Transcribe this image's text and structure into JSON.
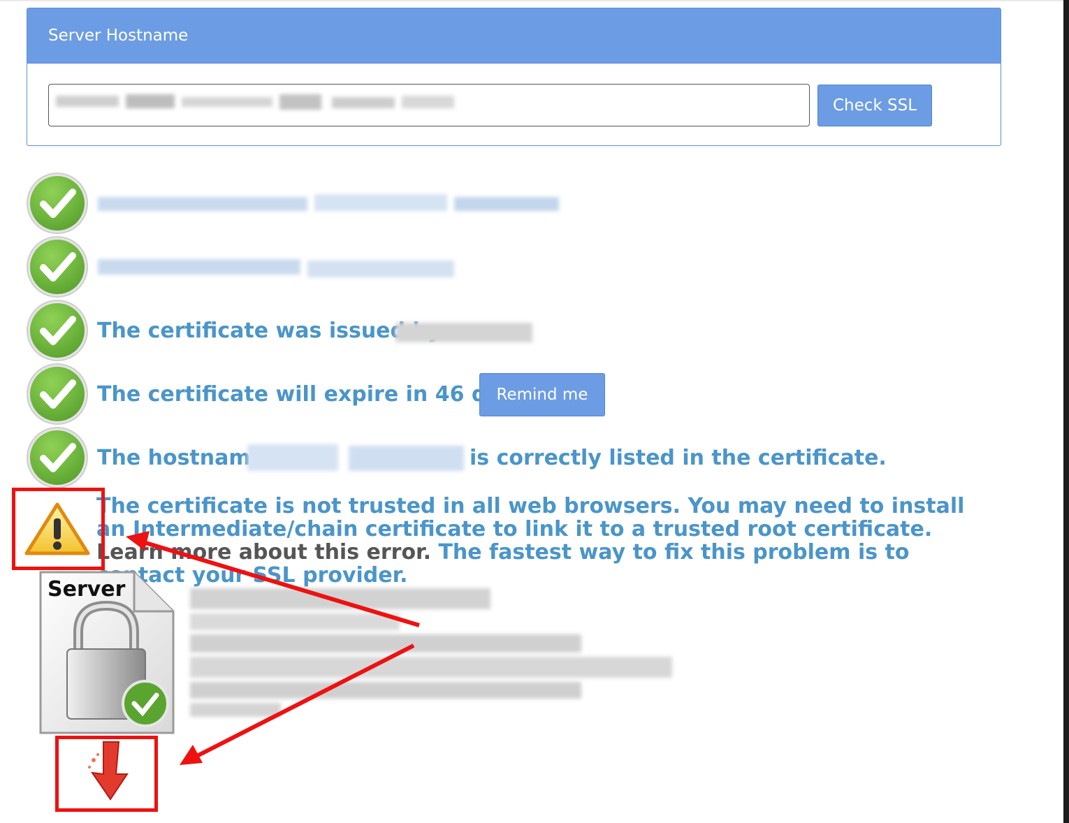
{
  "panel": {
    "title": "Server Hostname",
    "hostname_value": "",
    "check_button": "Check SSL"
  },
  "results": {
    "issued_by_text": "The certificate was issued by",
    "expire_text": "The certificate will expire in 46 days.",
    "remind_button": "Remind me",
    "hostname_prefix": "The hostname",
    "hostname_suffix": "is correctly listed in the certificate.",
    "warning_text": "The certificate is not trusted in all web browsers. You may need to install an Intermediate/chain certificate to link it to a trusted root certificate.",
    "learn_more": "Learn more about this error.",
    "warning_tail": "The fastest way to fix this problem is to contact your SSL provider."
  },
  "chain": {
    "server_label": "Server"
  },
  "colors": {
    "accent": "#6c9ce3",
    "result_text": "#4a95c9",
    "annotation_red": "#ee1111"
  },
  "icons": [
    "check-circle-icon",
    "warning-triangle-icon",
    "server-lock-certificate-icon",
    "broken-chain-arrow-icon"
  ]
}
